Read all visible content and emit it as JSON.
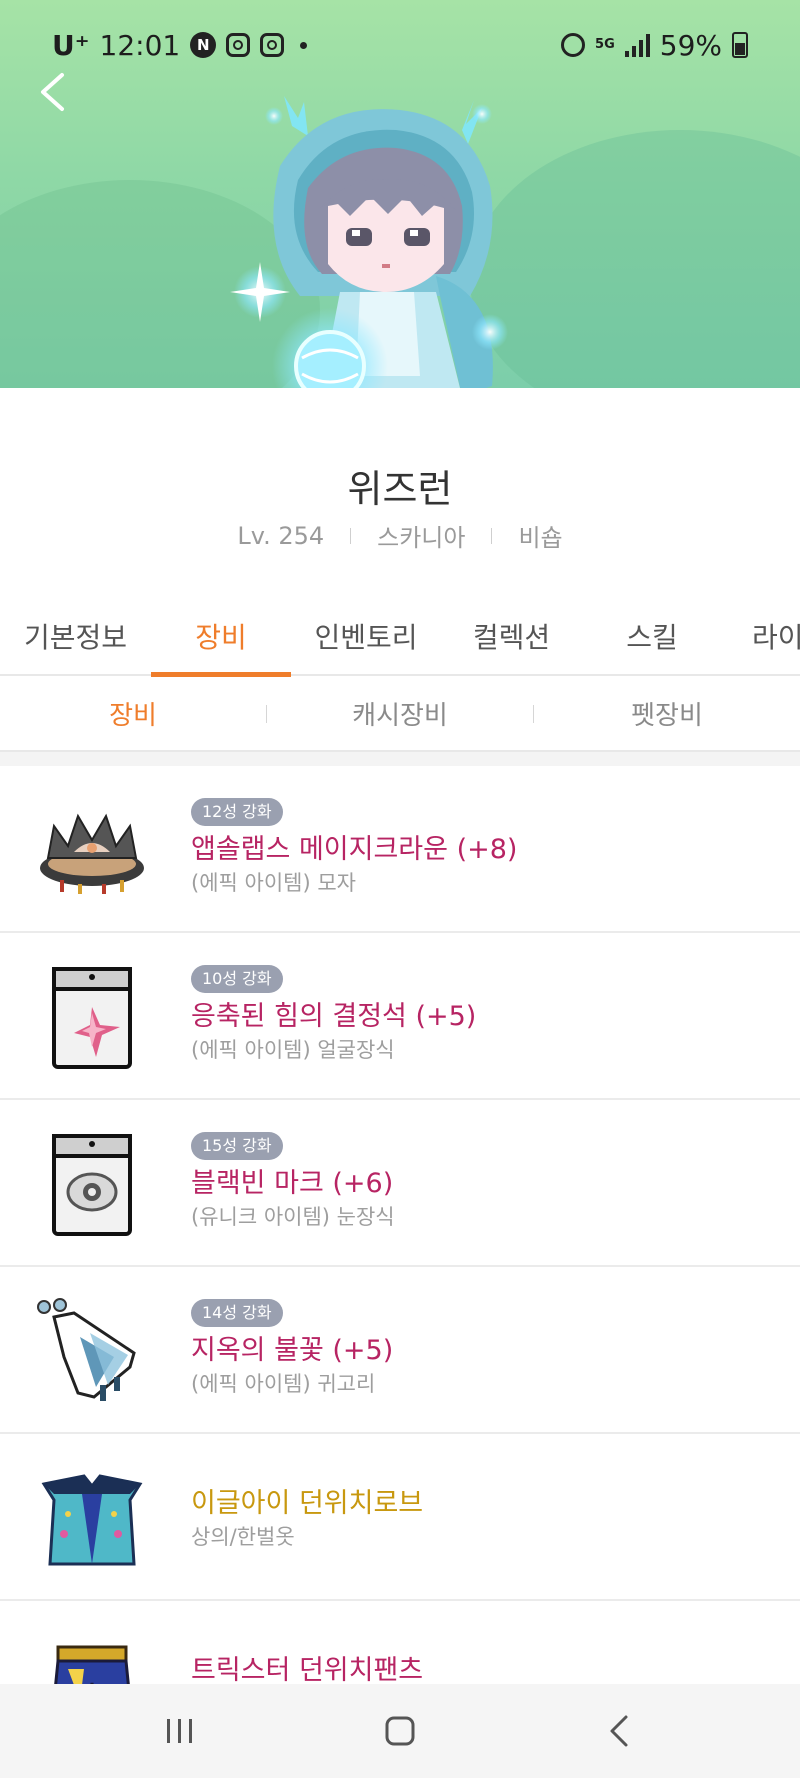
{
  "status_bar": {
    "carrier": "U⁺",
    "time": "12:01",
    "notification_icons": [
      "naver-icon",
      "instagram-icon",
      "instagram-icon"
    ],
    "network": "5G",
    "battery": "59%"
  },
  "hero": {
    "background_color": "#a6e3a6",
    "back_icon": "chevron-left-icon"
  },
  "profile": {
    "name": "위즈런",
    "level": "Lv. 254",
    "world": "스카니아",
    "guild": "비숍"
  },
  "main_tabs": [
    {
      "label": "기본정보",
      "active": false
    },
    {
      "label": "장비",
      "active": true
    },
    {
      "label": "인벤토리",
      "active": false
    },
    {
      "label": "컬렉션",
      "active": false
    },
    {
      "label": "스킬",
      "active": false
    },
    {
      "label": "라이",
      "active": false
    }
  ],
  "sub_tabs": [
    {
      "label": "장비",
      "active": true
    },
    {
      "label": "캐시장비",
      "active": false
    },
    {
      "label": "펫장비",
      "active": false
    }
  ],
  "equipment": [
    {
      "badge": "12성 강화",
      "name": "앱솔랩스 메이지크라운 (+8)",
      "type": "(에픽 아이템) 모자",
      "color": "#b72463",
      "icon": "crown-icon"
    },
    {
      "badge": "10성 강화",
      "name": "응축된 힘의 결정석 (+5)",
      "type": "(에픽 아이템) 얼굴장식",
      "color": "#b72463",
      "icon": "crystal-charm-icon"
    },
    {
      "badge": "15성 강화",
      "name": "블랙빈 마크 (+6)",
      "type": "(유니크 아이템) 눈장식",
      "color": "#b72463",
      "icon": "eye-mark-icon"
    },
    {
      "badge": "14성 강화",
      "name": "지옥의 불꽃 (+5)",
      "type": "(에픽 아이템) 귀고리",
      "color": "#b72463",
      "icon": "earring-icon"
    },
    {
      "badge": "",
      "name": "이글아이 던위치로브",
      "type": "상의/한벌옷",
      "color": "#c8980f",
      "icon": "robe-icon"
    },
    {
      "badge": "",
      "name": "트릭스터 던위치팬츠",
      "type": "",
      "color": "#b72463",
      "icon": "pants-icon"
    }
  ],
  "colors": {
    "accent": "#ef7d2b",
    "epic": "#b72463",
    "gold": "#c8980f"
  },
  "nav": {
    "recent_icon": "recent-apps-icon",
    "home_icon": "home-icon",
    "back_icon": "back-icon"
  }
}
